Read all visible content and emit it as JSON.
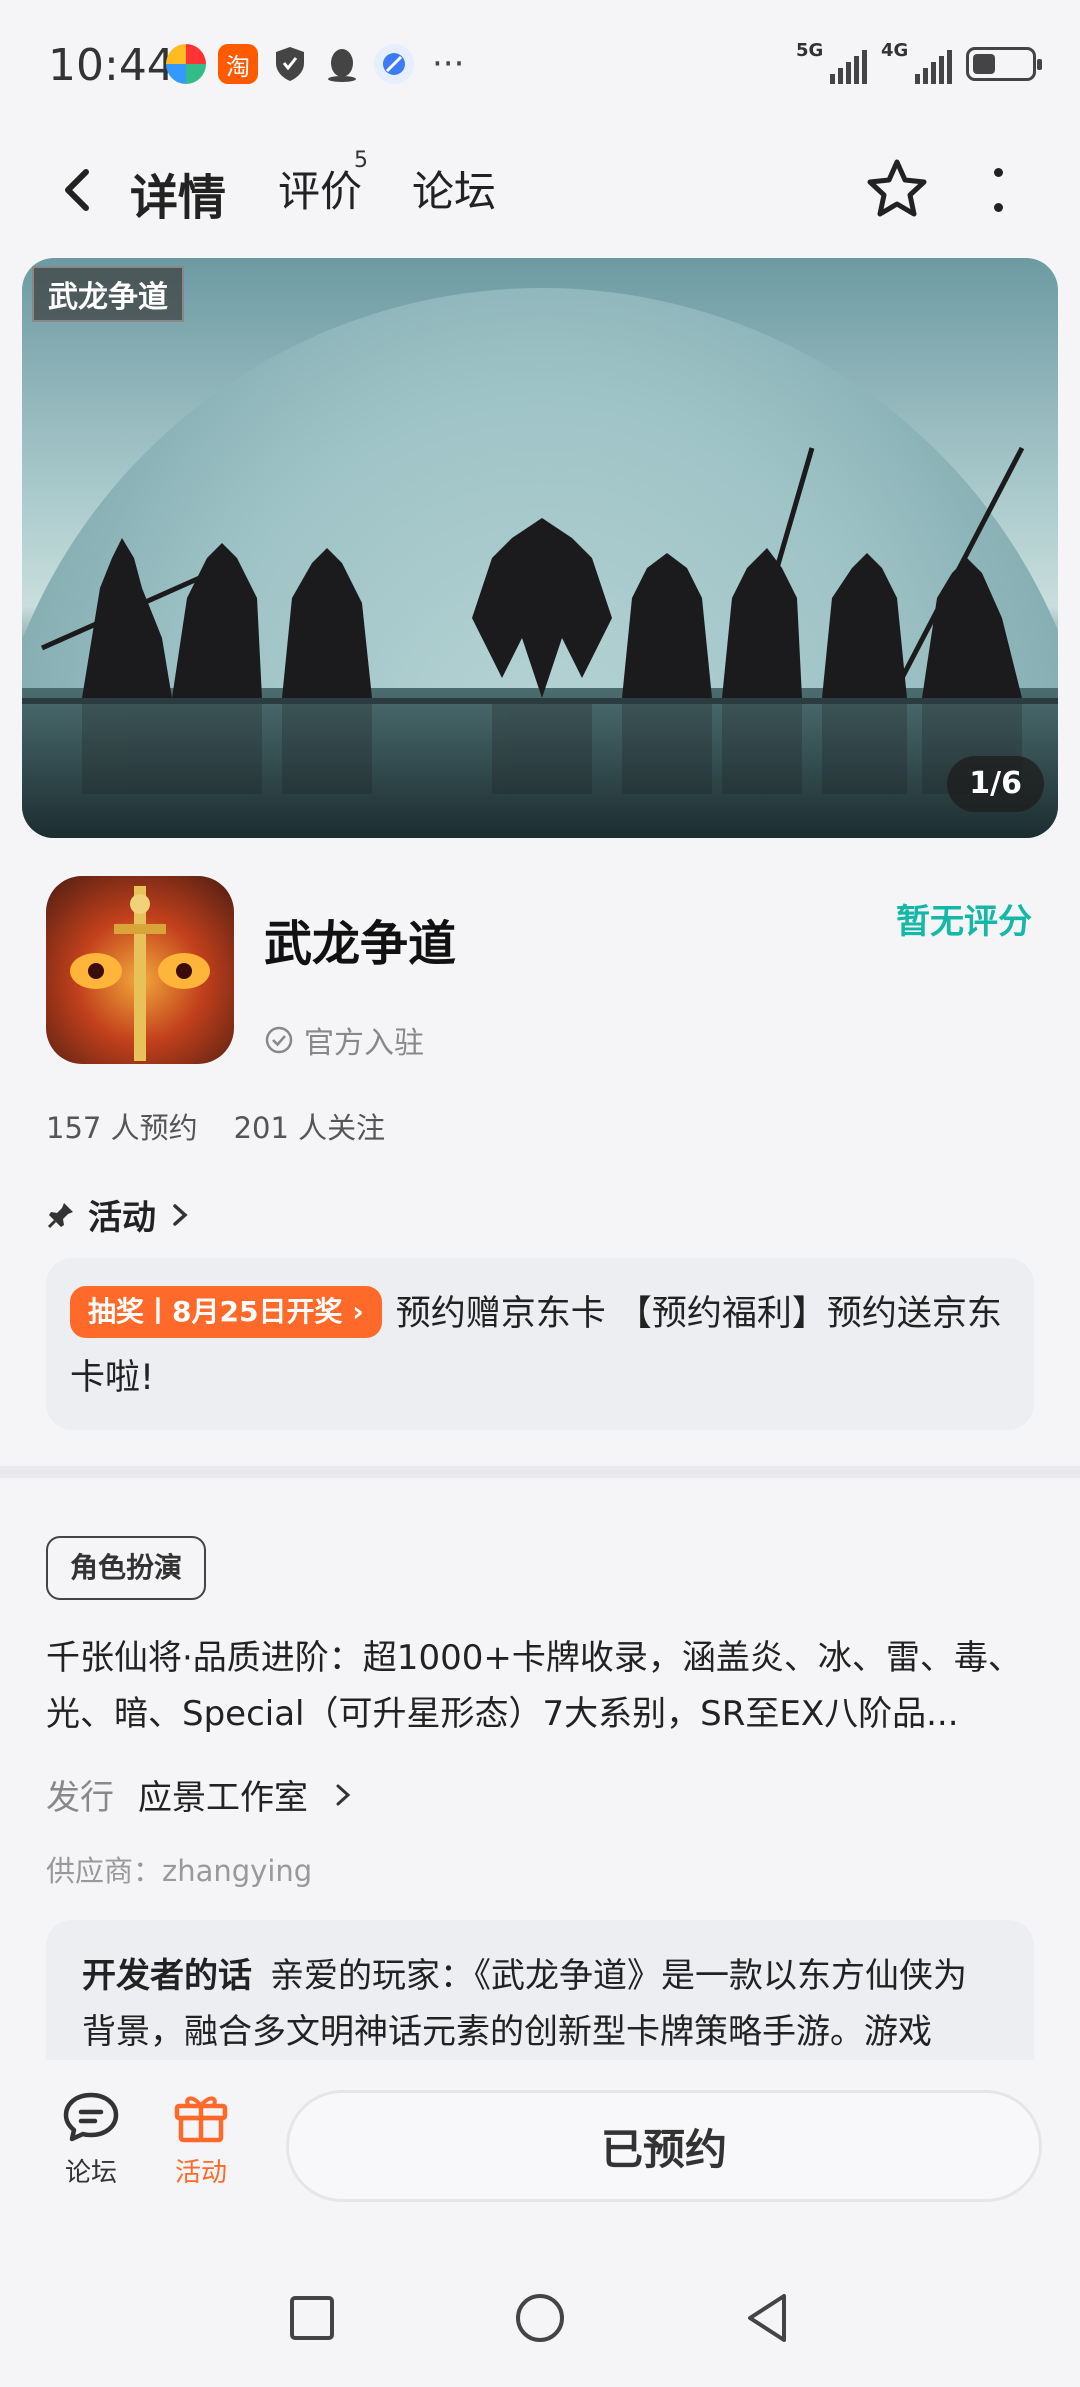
{
  "status_bar": {
    "time": "10:44",
    "notification_icons": [
      "colorful-app-icon",
      "taobao-icon",
      "shield-icon",
      "qq-icon",
      "browser-icon"
    ],
    "taobao_glyph": "淘",
    "more": "···",
    "signal_1_label": "5G",
    "signal_2_label": "4G"
  },
  "nav": {
    "tabs": [
      {
        "label": "详情",
        "active": true
      },
      {
        "label": "评价",
        "count": "5"
      },
      {
        "label": "论坛"
      }
    ]
  },
  "banner": {
    "logo_text": "武龙争道",
    "counter": "1/6"
  },
  "app": {
    "name": "武龙争道",
    "official_label": "官方入驻",
    "rating_text": "暂无评分",
    "reservations": "157 人预约",
    "followers": "201 人关注"
  },
  "activity": {
    "section_title": "活动",
    "badge": "抽奖丨8月25日开奖",
    "text": "预约赠京东卡 【预约福利】预约送京东卡啦!"
  },
  "details": {
    "tag": "角色扮演",
    "description": "千张仙将·品质进阶：超1000+卡牌收录，涵盖炎、冰、雷、毒、光、暗、Special（可升星形态）7大系别，SR至EX八阶品...",
    "publisher_label": "发行",
    "publisher": "应景工作室",
    "supplier": "供应商：zhangying",
    "dev_label": "开发者的话",
    "dev_text": "亲爱的玩家：《武龙争道》是一款以东方仙侠为背景，融合多文明神话元素的创新型卡牌策略手游。游戏"
  },
  "bottom_bar": {
    "forum_label": "论坛",
    "activity_label": "活动",
    "reserve_label": "已预约"
  },
  "colors": {
    "accent": "#18d3c4",
    "rating": "#14b8a6",
    "orange": "#ff6a2a"
  }
}
